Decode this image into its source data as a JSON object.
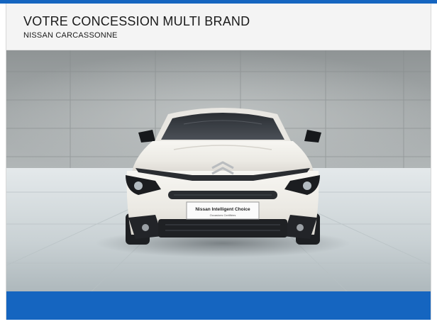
{
  "header": {
    "title": "VOTRE CONCESSION MULTI BRAND",
    "subtitle": "NISSAN CARCASSONNE"
  },
  "photo": {
    "plate_text": "Nissan Intelligent Choice",
    "plate_subtext": "Occasions Certifiées",
    "car_color": "#eeece6",
    "wall_color": "#9ea3a4",
    "floor_color": "#cfd6d9"
  },
  "colors": {
    "accent_blue": "#1565c0",
    "header_bg": "#f4f4f4"
  },
  "icons": {
    "brand_logo": "citroen-chevrons-logo"
  }
}
